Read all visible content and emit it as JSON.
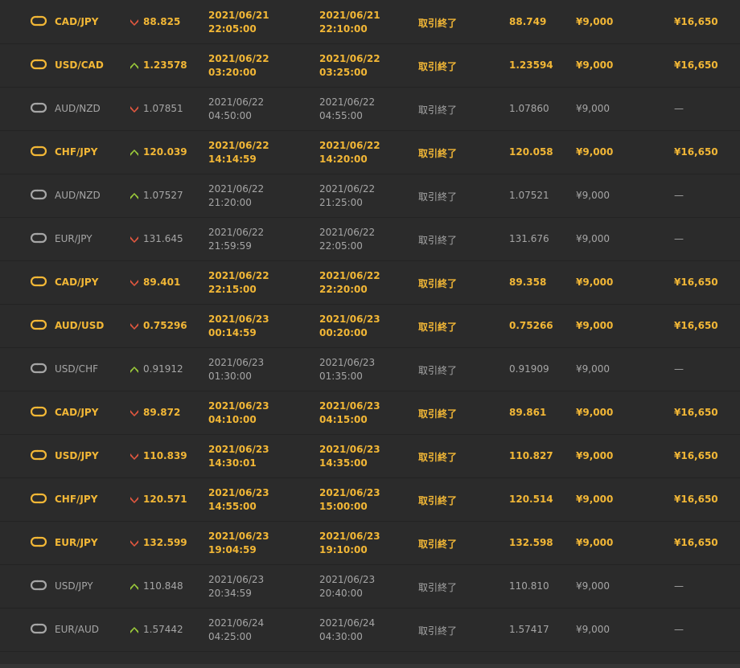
{
  "colors": {
    "background": "#2b2b2b",
    "win": "#f2b736",
    "loss": "#a6a6a6",
    "up_arrow": "#9ccc3a",
    "down_arrow": "#e2573f"
  },
  "icons": {
    "pair": "exchange-icon",
    "up": "arrow-up-icon",
    "down": "arrow-down-icon"
  },
  "trades": [
    {
      "pair": "CAD/JPY",
      "direction": "down",
      "entry": "88.825",
      "open_date": "2021/06/21",
      "open_time": "22:05:00",
      "close_date": "2021/06/21",
      "close_time": "22:10:00",
      "status": "取引終了",
      "close_rate": "88.749",
      "stake": "¥9,000",
      "payout": "¥16,650",
      "result": "win"
    },
    {
      "pair": "USD/CAD",
      "direction": "up",
      "entry": "1.23578",
      "open_date": "2021/06/22",
      "open_time": "03:20:00",
      "close_date": "2021/06/22",
      "close_time": "03:25:00",
      "status": "取引終了",
      "close_rate": "1.23594",
      "stake": "¥9,000",
      "payout": "¥16,650",
      "result": "win"
    },
    {
      "pair": "AUD/NZD",
      "direction": "down",
      "entry": "1.07851",
      "open_date": "2021/06/22",
      "open_time": "04:50:00",
      "close_date": "2021/06/22",
      "close_time": "04:55:00",
      "status": "取引終了",
      "close_rate": "1.07860",
      "stake": "¥9,000",
      "payout": "—",
      "result": "lose"
    },
    {
      "pair": "CHF/JPY",
      "direction": "up",
      "entry": "120.039",
      "open_date": "2021/06/22",
      "open_time": "14:14:59",
      "close_date": "2021/06/22",
      "close_time": "14:20:00",
      "status": "取引終了",
      "close_rate": "120.058",
      "stake": "¥9,000",
      "payout": "¥16,650",
      "result": "win"
    },
    {
      "pair": "AUD/NZD",
      "direction": "up",
      "entry": "1.07527",
      "open_date": "2021/06/22",
      "open_time": "21:20:00",
      "close_date": "2021/06/22",
      "close_time": "21:25:00",
      "status": "取引終了",
      "close_rate": "1.07521",
      "stake": "¥9,000",
      "payout": "—",
      "result": "lose"
    },
    {
      "pair": "EUR/JPY",
      "direction": "down",
      "entry": "131.645",
      "open_date": "2021/06/22",
      "open_time": "21:59:59",
      "close_date": "2021/06/22",
      "close_time": "22:05:00",
      "status": "取引終了",
      "close_rate": "131.676",
      "stake": "¥9,000",
      "payout": "—",
      "result": "lose"
    },
    {
      "pair": "CAD/JPY",
      "direction": "down",
      "entry": "89.401",
      "open_date": "2021/06/22",
      "open_time": "22:15:00",
      "close_date": "2021/06/22",
      "close_time": "22:20:00",
      "status": "取引終了",
      "close_rate": "89.358",
      "stake": "¥9,000",
      "payout": "¥16,650",
      "result": "win"
    },
    {
      "pair": "AUD/USD",
      "direction": "down",
      "entry": "0.75296",
      "open_date": "2021/06/23",
      "open_time": "00:14:59",
      "close_date": "2021/06/23",
      "close_time": "00:20:00",
      "status": "取引終了",
      "close_rate": "0.75266",
      "stake": "¥9,000",
      "payout": "¥16,650",
      "result": "win"
    },
    {
      "pair": "USD/CHF",
      "direction": "up",
      "entry": "0.91912",
      "open_date": "2021/06/23",
      "open_time": "01:30:00",
      "close_date": "2021/06/23",
      "close_time": "01:35:00",
      "status": "取引終了",
      "close_rate": "0.91909",
      "stake": "¥9,000",
      "payout": "—",
      "result": "lose"
    },
    {
      "pair": "CAD/JPY",
      "direction": "down",
      "entry": "89.872",
      "open_date": "2021/06/23",
      "open_time": "04:10:00",
      "close_date": "2021/06/23",
      "close_time": "04:15:00",
      "status": "取引終了",
      "close_rate": "89.861",
      "stake": "¥9,000",
      "payout": "¥16,650",
      "result": "win"
    },
    {
      "pair": "USD/JPY",
      "direction": "down",
      "entry": "110.839",
      "open_date": "2021/06/23",
      "open_time": "14:30:01",
      "close_date": "2021/06/23",
      "close_time": "14:35:00",
      "status": "取引終了",
      "close_rate": "110.827",
      "stake": "¥9,000",
      "payout": "¥16,650",
      "result": "win"
    },
    {
      "pair": "CHF/JPY",
      "direction": "down",
      "entry": "120.571",
      "open_date": "2021/06/23",
      "open_time": "14:55:00",
      "close_date": "2021/06/23",
      "close_time": "15:00:00",
      "status": "取引終了",
      "close_rate": "120.514",
      "stake": "¥9,000",
      "payout": "¥16,650",
      "result": "win"
    },
    {
      "pair": "EUR/JPY",
      "direction": "down",
      "entry": "132.599",
      "open_date": "2021/06/23",
      "open_time": "19:04:59",
      "close_date": "2021/06/23",
      "close_time": "19:10:00",
      "status": "取引終了",
      "close_rate": "132.598",
      "stake": "¥9,000",
      "payout": "¥16,650",
      "result": "win"
    },
    {
      "pair": "USD/JPY",
      "direction": "up",
      "entry": "110.848",
      "open_date": "2021/06/23",
      "open_time": "20:34:59",
      "close_date": "2021/06/23",
      "close_time": "20:40:00",
      "status": "取引終了",
      "close_rate": "110.810",
      "stake": "¥9,000",
      "payout": "—",
      "result": "lose"
    },
    {
      "pair": "EUR/AUD",
      "direction": "up",
      "entry": "1.57442",
      "open_date": "2021/06/24",
      "open_time": "04:25:00",
      "close_date": "2021/06/24",
      "close_time": "04:30:00",
      "status": "取引終了",
      "close_rate": "1.57417",
      "stake": "¥9,000",
      "payout": "—",
      "result": "lose"
    }
  ]
}
